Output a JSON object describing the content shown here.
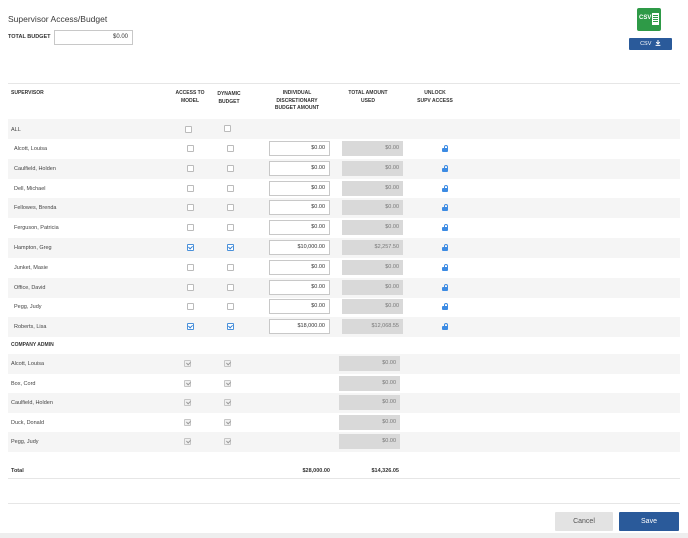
{
  "page_title": "Supervisor Access/Budget",
  "total_budget": {
    "label": "TOTAL BUDGET",
    "value": "$0.00"
  },
  "export": {
    "icon_text": "CSV",
    "button_label": "CSV",
    "icon": "download-icon"
  },
  "columns": {
    "supervisor": "SUPERVISOR",
    "access_to_model": [
      "ACCESS TO",
      "MODEL"
    ],
    "dynamic_budget": [
      "DYNAMIC",
      "BUDGET"
    ],
    "individual_budget": [
      "INDIVIDUAL",
      "DISCRETIONARY",
      "BUDGET AMOUNT"
    ],
    "total_used": [
      "TOTAL AMOUNT",
      "USED"
    ],
    "unlock": [
      "UNLOCK",
      "SUPV ACCESS"
    ]
  },
  "all_row": {
    "label": "ALL",
    "access": false,
    "dynamic": false
  },
  "supervisors": [
    {
      "name": "Alcott, Louisa",
      "access": false,
      "dynamic": false,
      "budget": "$0.00",
      "used": "$0.00"
    },
    {
      "name": "Caulfield, Holden",
      "access": false,
      "dynamic": false,
      "budget": "$0.00",
      "used": "$0.00"
    },
    {
      "name": "Dell, Michael",
      "access": false,
      "dynamic": false,
      "budget": "$0.00",
      "used": "$0.00"
    },
    {
      "name": "Fellowes, Brenda",
      "access": false,
      "dynamic": false,
      "budget": "$0.00",
      "used": "$0.00"
    },
    {
      "name": "Ferguson, Patricia",
      "access": false,
      "dynamic": false,
      "budget": "$0.00",
      "used": "$0.00"
    },
    {
      "name": "Hampton, Greg",
      "access": true,
      "dynamic": true,
      "budget": "$10,000.00",
      "used": "$2,257.50"
    },
    {
      "name": "Junket, Masie",
      "access": false,
      "dynamic": false,
      "budget": "$0.00",
      "used": "$0.00"
    },
    {
      "name": "Office, David",
      "access": false,
      "dynamic": false,
      "budget": "$0.00",
      "used": "$0.00"
    },
    {
      "name": "Pegg, Judy",
      "access": false,
      "dynamic": false,
      "budget": "$0.00",
      "used": "$0.00"
    },
    {
      "name": "Roberts, Lisa",
      "access": true,
      "dynamic": true,
      "budget": "$18,000.00",
      "used": "$12,068.55"
    }
  ],
  "company_admin": {
    "label": "COMPANY ADMIN",
    "rows": [
      {
        "name": "Alcott, Louisa",
        "used": "$0.00"
      },
      {
        "name": "Box, Cord",
        "used": "$0.00"
      },
      {
        "name": "Caulfield, Holden",
        "used": "$0.00"
      },
      {
        "name": "Duck, Donald",
        "used": "$0.00"
      },
      {
        "name": "Pegg, Judy",
        "used": "$0.00"
      }
    ]
  },
  "totals": {
    "label": "Total",
    "budget": "$28,000.00",
    "used": "$14,326.05"
  },
  "footer": {
    "cancel_label": "Cancel",
    "save_label": "Save"
  },
  "colors": {
    "primary": "#2a5a9a",
    "csv_green": "#2e9a47",
    "check_blue": "#2f7fd6"
  }
}
